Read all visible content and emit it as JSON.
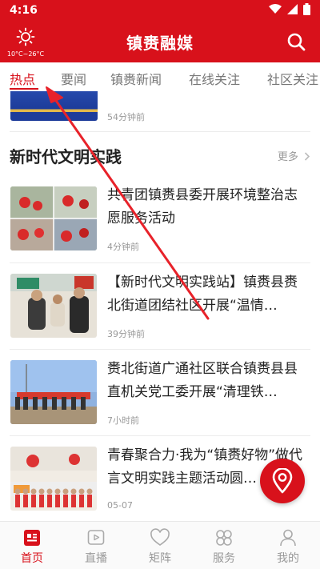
{
  "status": {
    "time": "4:16"
  },
  "header": {
    "weather_temp": "10°C~26°C",
    "title": "镇赉融媒"
  },
  "tabs": [
    {
      "label": "热点",
      "active": true
    },
    {
      "label": "要闻"
    },
    {
      "label": "镇赉新闻"
    },
    {
      "label": "在线关注"
    },
    {
      "label": "社区关注"
    }
  ],
  "top_item": {
    "time": "54分钟前"
  },
  "section": {
    "title": "新时代文明实践",
    "more": "更多"
  },
  "news": [
    {
      "title": "共青团镇赉县委开展环境整治志愿服务活动",
      "time": "4分钟前"
    },
    {
      "title": "【新时代文明实践站】镇赉县赉北街道团结社区开展“温情…",
      "time": "39分钟前"
    },
    {
      "title": "赉北街道广通社区联合镇赉县县直机关党工委开展“清理铁…",
      "time": "7小时前"
    },
    {
      "title": "青春聚合力·我为“镇赉好物”做代言文明实践主题活动圆…",
      "time": "05-07"
    }
  ],
  "bottom_nav": [
    {
      "label": "首页",
      "icon": "home-icon",
      "active": true
    },
    {
      "label": "直播",
      "icon": "live-icon"
    },
    {
      "label": "矩阵",
      "icon": "heart-icon"
    },
    {
      "label": "服务",
      "icon": "grid-icon"
    },
    {
      "label": "我的",
      "icon": "user-icon"
    }
  ],
  "colors": {
    "brand_red": "#d8111b",
    "muted": "#999999"
  }
}
